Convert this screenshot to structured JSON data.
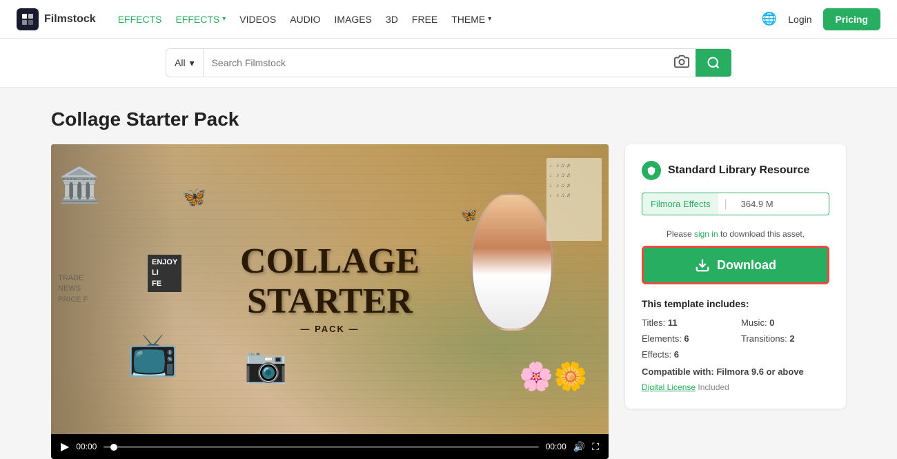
{
  "header": {
    "logo_text": "Filmstock",
    "logo_icon": "F",
    "nav": [
      {
        "label": "EFFECTS",
        "green": true,
        "has_dropdown": false
      },
      {
        "label": "EFFECTS",
        "green": true,
        "has_dropdown": true
      },
      {
        "label": "VIDEOS",
        "green": false,
        "has_dropdown": false
      },
      {
        "label": "AUDIO",
        "green": false,
        "has_dropdown": false
      },
      {
        "label": "IMAGES",
        "green": false,
        "has_dropdown": false
      },
      {
        "label": "3D",
        "green": false,
        "has_dropdown": false
      },
      {
        "label": "FREE",
        "green": false,
        "has_dropdown": false
      },
      {
        "label": "THEME",
        "green": false,
        "has_dropdown": true
      }
    ],
    "login_label": "Login",
    "pricing_label": "Pricing"
  },
  "search": {
    "category": "All",
    "placeholder": "Search Filmstock"
  },
  "page": {
    "title": "Collage Starter Pack"
  },
  "video": {
    "collage_line1": "COLLAGE",
    "collage_line2": "STARTER",
    "collage_line3": "PACK",
    "deco_dash": "—",
    "time_start": "00:00",
    "time_end": "00:00"
  },
  "resource": {
    "badge_icon": "shield",
    "title": "Standard Library Resource",
    "format_label": "Filmora Effects",
    "format_size": "364.9 M",
    "sign_in_prefix": "Please ",
    "sign_in_link": "sign in",
    "sign_in_suffix": " to download this asset,",
    "download_label": "Download",
    "template_includes_label": "This template includes:",
    "stats": [
      {
        "label": "Titles:",
        "value": "11"
      },
      {
        "label": "Music:",
        "value": "0"
      },
      {
        "label": "Elements:",
        "value": "6"
      },
      {
        "label": "Transitions:",
        "value": "2"
      },
      {
        "label": "Effects:",
        "value": "6"
      },
      {
        "label": "",
        "value": ""
      }
    ],
    "compatible_prefix": "Compatible with: ",
    "compatible_value": "Filmora 9.6 or above",
    "license_link": "Digital License",
    "license_suffix": " Included"
  }
}
